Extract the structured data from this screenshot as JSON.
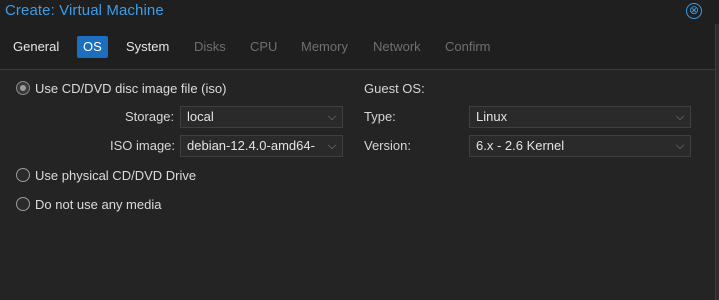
{
  "window": {
    "title": "Create: Virtual Machine",
    "close_icon": "⊗"
  },
  "tabs": [
    {
      "label": "General",
      "state": "normal"
    },
    {
      "label": "OS",
      "state": "active"
    },
    {
      "label": "System",
      "state": "normal"
    },
    {
      "label": "Disks",
      "state": "disabled"
    },
    {
      "label": "CPU",
      "state": "disabled"
    },
    {
      "label": "Memory",
      "state": "disabled"
    },
    {
      "label": "Network",
      "state": "disabled"
    },
    {
      "label": "Confirm",
      "state": "disabled"
    }
  ],
  "media": {
    "options": [
      {
        "label": "Use CD/DVD disc image file (iso)",
        "checked": true
      },
      {
        "label": "Use physical CD/DVD Drive",
        "checked": false
      },
      {
        "label": "Do not use any media",
        "checked": false
      }
    ],
    "storage": {
      "label": "Storage:",
      "value": "local"
    },
    "iso": {
      "label": "ISO image:",
      "value": "debian-12.4.0-amd64-"
    }
  },
  "guest_os": {
    "heading": "Guest OS:",
    "type": {
      "label": "Type:",
      "value": "Linux"
    },
    "version": {
      "label": "Version:",
      "value": "6.x - 2.6 Kernel"
    }
  },
  "colors": {
    "accent": "#3d9ce6",
    "active_tab": "#1c6fbf",
    "background": "#242424"
  }
}
